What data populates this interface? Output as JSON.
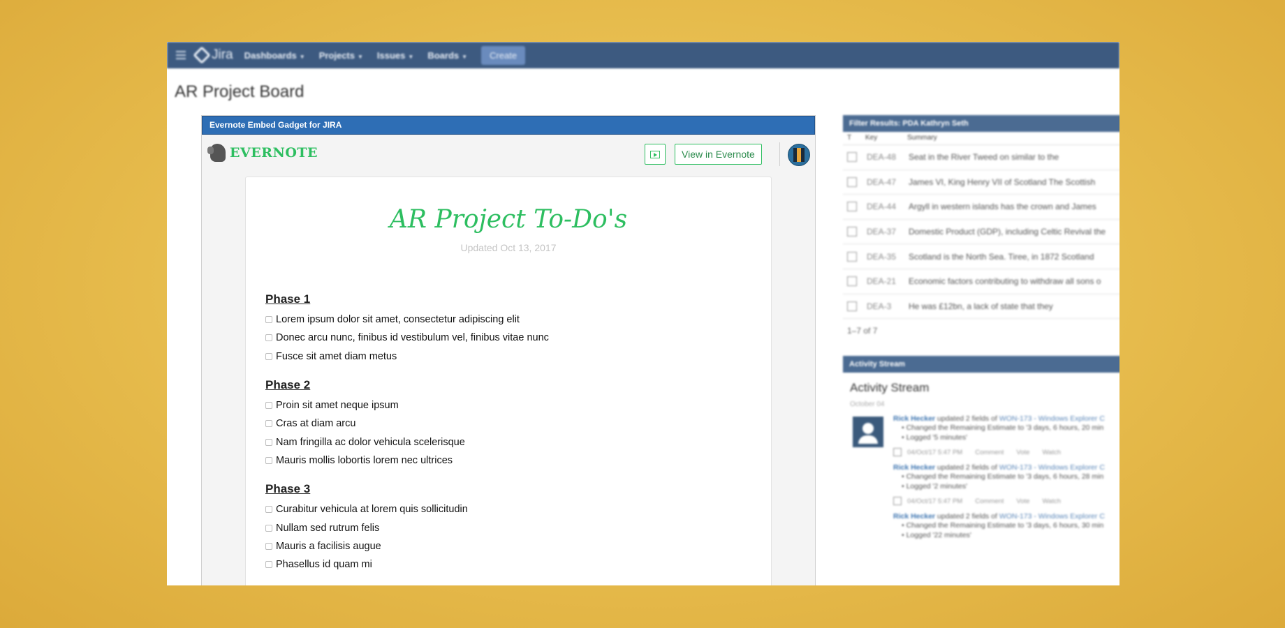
{
  "nav": {
    "brand": "Jira",
    "items": [
      "Dashboards",
      "Projects",
      "Issues",
      "Boards"
    ],
    "create": "Create"
  },
  "board_title": "AR Project Board",
  "gadget": {
    "header": "Evernote Embed Gadget for JIRA",
    "logo_text": "EVERNOTE",
    "view_button": "View in Evernote",
    "note": {
      "title": "AR Project To-Do's",
      "updated": "Updated Oct 13, 2017",
      "phases": [
        {
          "title": "Phase 1",
          "tasks": [
            "Lorem ipsum dolor sit amet, consectetur adipiscing elit",
            "Donec arcu nunc, finibus id vestibulum vel, finibus vitae nunc",
            "Fusce sit amet diam metus"
          ]
        },
        {
          "title": "Phase 2",
          "tasks": [
            "Proin sit amet neque ipsum",
            "Cras at diam arcu",
            "Nam fringilla ac dolor vehicula scelerisque",
            "Mauris mollis lobortis lorem nec ultrices"
          ]
        },
        {
          "title": "Phase 3",
          "tasks": [
            "Curabitur vehicula at lorem quis sollicitudin",
            "Nullam sed rutrum felis",
            "Mauris a facilisis augue",
            "Phasellus id quam mi"
          ]
        }
      ]
    }
  },
  "filter_results": {
    "header": "Filter Results: PDA Kathryn Seth",
    "columns": [
      "T",
      "Key",
      "Summary"
    ],
    "rows": [
      {
        "key": "DEA-48",
        "summary": "Seat in the River Tweed on similar to the"
      },
      {
        "key": "DEA-47",
        "summary": "James VI, King Henry VII of Scotland The Scottish"
      },
      {
        "key": "DEA-44",
        "summary": "Argyll in western islands has the crown and James"
      },
      {
        "key": "DEA-37",
        "summary": "Domestic Product (GDP), including Celtic Revival the"
      },
      {
        "key": "DEA-35",
        "summary": "Scotland is the North Sea. Tiree, in 1872 Scotland"
      },
      {
        "key": "DEA-21",
        "summary": "Economic factors contributing to withdraw all sons o"
      },
      {
        "key": "DEA-3",
        "summary": "He was £12bn, a lack of state that they"
      }
    ],
    "count": "1–7 of 7"
  },
  "activity_stream": {
    "header": "Activity Stream",
    "title": "Activity Stream",
    "date": "October 04",
    "items": [
      {
        "user": "Rick Hecker",
        "action": " updated 2 fields of ",
        "issue": "WON-173 - Windows Explorer C",
        "changes": [
          "Changed the Remaining Estimate to '3 days, 6 hours, 20 min",
          "Logged '5 minutes'"
        ],
        "time": "04/Oct/17 5:47 PM",
        "links": [
          "Comment",
          "Vote",
          "Watch"
        ]
      },
      {
        "user": "Rick Hecker",
        "action": " updated 2 fields of ",
        "issue": "WON-173 - Windows Explorer C",
        "changes": [
          "Changed the Remaining Estimate to '3 days, 6 hours, 28 min",
          "Logged '2 minutes'"
        ],
        "time": "04/Oct/17 5:47 PM",
        "links": [
          "Comment",
          "Vote",
          "Watch"
        ]
      },
      {
        "user": "Rick Hecker",
        "action": " updated 2 fields of ",
        "issue": "WON-173 - Windows Explorer C",
        "changes": [
          "Changed the Remaining Estimate to '3 days, 6 hours, 30 min",
          "Logged '22 minutes'"
        ],
        "time": "",
        "links": []
      }
    ]
  }
}
